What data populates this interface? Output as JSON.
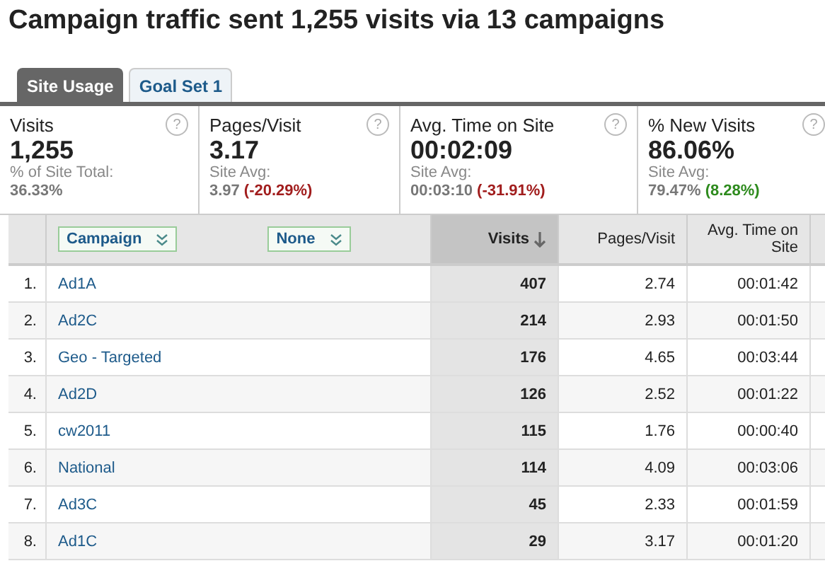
{
  "title": "Campaign traffic sent 1,255 visits via 13 campaigns",
  "tabs": [
    {
      "label": "Site Usage",
      "selected": true
    },
    {
      "label": "Goal Set 1",
      "selected": false
    }
  ],
  "metrics": [
    {
      "label": "Visits",
      "help": "?",
      "value": "1,255",
      "sub_label": "% of Site Total:",
      "sub_value": "36.33%"
    },
    {
      "label": "Pages/Visit",
      "help": "?",
      "value": "3.17",
      "sub_label": "Site Avg:",
      "sub_value": "3.97",
      "change": "(-20.29%)",
      "color": "#a11d1d"
    },
    {
      "label": "Avg. Time on Site",
      "help": "?",
      "value": "00:02:09",
      "sub_label": "Site Avg:",
      "sub_value": "00:03:10",
      "change": "(-31.91%)",
      "color": "#a11d1d"
    },
    {
      "label": "% New Visits",
      "help": "?",
      "value": "86.06%",
      "sub_label": "Site Avg:",
      "sub_value": "79.47%",
      "change": "(8.28%)",
      "color": "#2e8b1e"
    }
  ],
  "dimension_selectors": [
    {
      "label": "Campaign"
    },
    {
      "label": "None"
    }
  ],
  "columns": [
    {
      "label": "Visits",
      "selected": true
    },
    {
      "label": "Pages/Visit",
      "selected": false
    },
    {
      "label": "Avg. Time on Site",
      "selected": false
    }
  ],
  "rows": [
    {
      "rank": "1.",
      "campaign": "Ad1A",
      "visits": "407",
      "pages_visit": "2.74",
      "avg_time": "00:01:42"
    },
    {
      "rank": "2.",
      "campaign": "Ad2C",
      "visits": "214",
      "pages_visit": "2.93",
      "avg_time": "00:01:50"
    },
    {
      "rank": "3.",
      "campaign": "Geo - Targeted",
      "visits": "176",
      "pages_visit": "4.65",
      "avg_time": "00:03:44"
    },
    {
      "rank": "4.",
      "campaign": "Ad2D",
      "visits": "126",
      "pages_visit": "2.52",
      "avg_time": "00:01:22"
    },
    {
      "rank": "5.",
      "campaign": "cw2011",
      "visits": "115",
      "pages_visit": "1.76",
      "avg_time": "00:00:40"
    },
    {
      "rank": "6.",
      "campaign": "National",
      "visits": "114",
      "pages_visit": "4.09",
      "avg_time": "00:03:06"
    },
    {
      "rank": "7.",
      "campaign": "Ad3C",
      "visits": "45",
      "pages_visit": "2.33",
      "avg_time": "00:01:59"
    },
    {
      "rank": "8.",
      "campaign": "Ad1C",
      "visits": "29",
      "pages_visit": "3.17",
      "avg_time": "00:01:20"
    }
  ]
}
